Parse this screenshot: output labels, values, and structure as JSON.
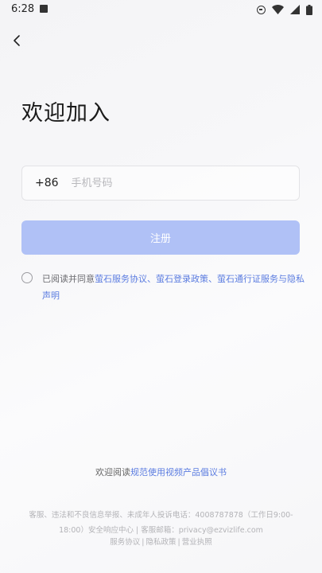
{
  "status_bar": {
    "time": "6:28",
    "icons": [
      "app-notification-icon",
      "do-not-disturb-icon",
      "wifi-icon",
      "signal-icon",
      "battery-icon"
    ]
  },
  "header": {
    "back_icon": "chevron-left-icon"
  },
  "title": "欢迎加入",
  "phone": {
    "country_code": "+86",
    "placeholder": "手机号码",
    "value": ""
  },
  "register_button": {
    "label": "注册",
    "color": "#b0c1f6"
  },
  "agreement": {
    "prefix": "已阅读并同意",
    "link1": "萤石服务协议",
    "sep1": "、",
    "link2": "萤石登录政策",
    "sep2": "、",
    "link3": "萤石通行证服务与隐私声明",
    "checked": false,
    "link_color": "#5b7ce0"
  },
  "read_notice": {
    "prefix": "欢迎阅读",
    "link": "规范使用视频产品倡议书"
  },
  "footer": {
    "line1": "客服、违法和不良信息举报、未成年人投诉电话：4008787878（工作日9:00-18:00）安全响应中心 | 客服邮箱：privacy@ezvizlife.com",
    "links": [
      "服务协议",
      "隐私政策",
      "营业执照"
    ],
    "separator": "|"
  }
}
